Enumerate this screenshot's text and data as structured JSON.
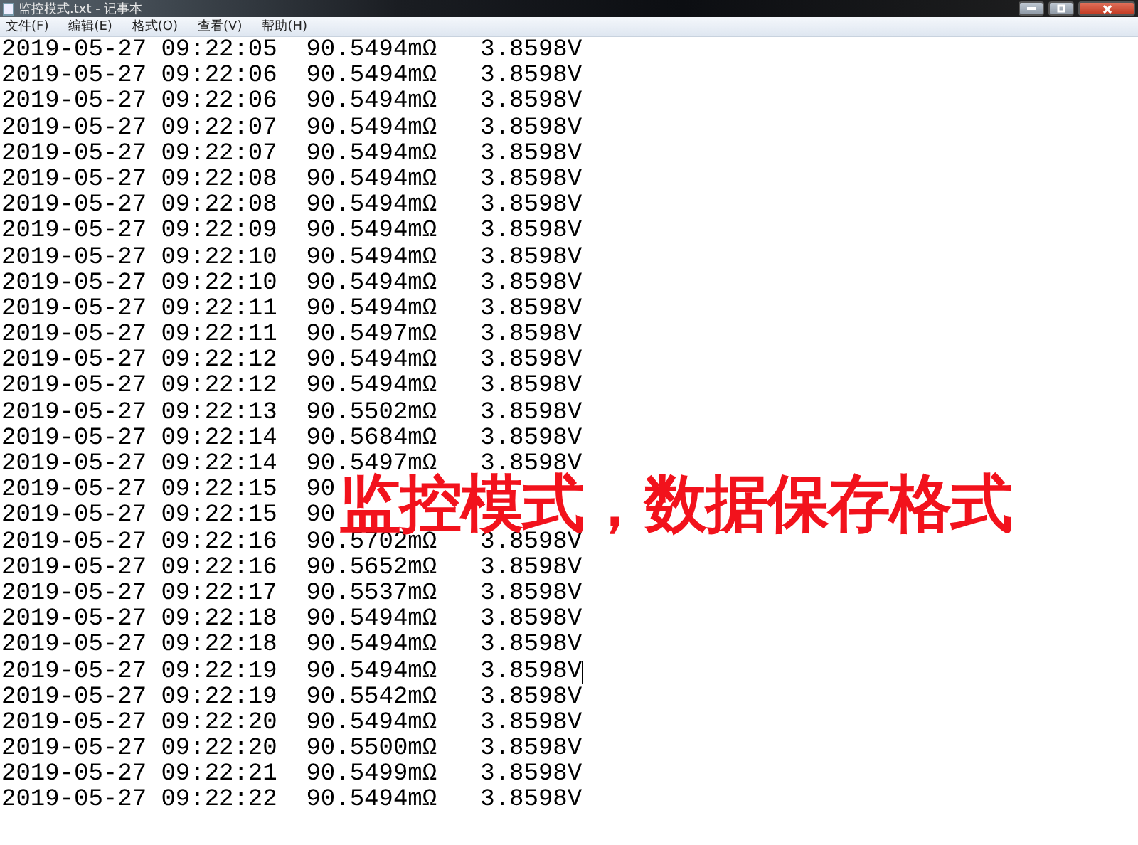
{
  "window": {
    "title": "监控模式.txt - 记事本"
  },
  "menu": [
    "文件(F)",
    "编辑(E)",
    "格式(O)",
    "查看(V)",
    "帮助(H)"
  ],
  "lines": [
    {
      "text": "2019-05-27 09:22:05  90.5494mΩ   3.8598V",
      "caret": false
    },
    {
      "text": "2019-05-27 09:22:06  90.5494mΩ   3.8598V",
      "caret": false
    },
    {
      "text": "2019-05-27 09:22:06  90.5494mΩ   3.8598V",
      "caret": false
    },
    {
      "text": "2019-05-27 09:22:07  90.5494mΩ   3.8598V",
      "caret": false
    },
    {
      "text": "2019-05-27 09:22:07  90.5494mΩ   3.8598V",
      "caret": false
    },
    {
      "text": "2019-05-27 09:22:08  90.5494mΩ   3.8598V",
      "caret": false
    },
    {
      "text": "2019-05-27 09:22:08  90.5494mΩ   3.8598V",
      "caret": false
    },
    {
      "text": "2019-05-27 09:22:09  90.5494mΩ   3.8598V",
      "caret": false
    },
    {
      "text": "2019-05-27 09:22:10  90.5494mΩ   3.8598V",
      "caret": false
    },
    {
      "text": "2019-05-27 09:22:10  90.5494mΩ   3.8598V",
      "caret": false
    },
    {
      "text": "2019-05-27 09:22:11  90.5494mΩ   3.8598V",
      "caret": false
    },
    {
      "text": "2019-05-27 09:22:11  90.5497mΩ   3.8598V",
      "caret": false
    },
    {
      "text": "2019-05-27 09:22:12  90.5494mΩ   3.8598V",
      "caret": false
    },
    {
      "text": "2019-05-27 09:22:12  90.5494mΩ   3.8598V",
      "caret": false
    },
    {
      "text": "2019-05-27 09:22:13  90.5502mΩ   3.8598V",
      "caret": false
    },
    {
      "text": "2019-05-27 09:22:14  90.5684mΩ   3.8598V",
      "caret": false
    },
    {
      "text": "2019-05-27 09:22:14  90.5497mΩ   3.8598V",
      "caret": false
    },
    {
      "text": "2019-05-27 09:22:15  90",
      "caret": false
    },
    {
      "text": "2019-05-27 09:22:15  90",
      "caret": false
    },
    {
      "text": "2019-05-27 09:22:16  90.5702mΩ   3.8598V",
      "caret": false
    },
    {
      "text": "2019-05-27 09:22:16  90.5652mΩ   3.8598V",
      "caret": false
    },
    {
      "text": "2019-05-27 09:22:17  90.5537mΩ   3.8598V",
      "caret": false
    },
    {
      "text": "2019-05-27 09:22:18  90.5494mΩ   3.8598V",
      "caret": false
    },
    {
      "text": "2019-05-27 09:22:18  90.5494mΩ   3.8598V",
      "caret": false
    },
    {
      "text": "2019-05-27 09:22:19  90.5494mΩ   3.8598V",
      "caret": true
    },
    {
      "text": "2019-05-27 09:22:19  90.5542mΩ   3.8598V",
      "caret": false
    },
    {
      "text": "2019-05-27 09:22:20  90.5494mΩ   3.8598V",
      "caret": false
    },
    {
      "text": "2019-05-27 09:22:20  90.5500mΩ   3.8598V",
      "caret": false
    },
    {
      "text": "2019-05-27 09:22:21  90.5499mΩ   3.8598V",
      "caret": false
    },
    {
      "text": "2019-05-27 09:22:22  90.5494mΩ   3.8598V",
      "caret": false
    }
  ],
  "caption": "监控模式，数据保存格式"
}
